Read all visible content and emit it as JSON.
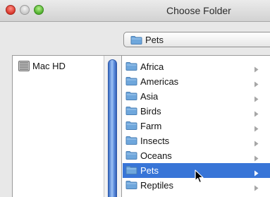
{
  "window": {
    "title": "Choose Folder"
  },
  "path_popup": {
    "selected": "Pets",
    "icon": "folder-icon"
  },
  "sidebar": {
    "items": [
      {
        "label": "Mac HD",
        "icon": "hard-drive-icon"
      }
    ]
  },
  "column": {
    "items": [
      {
        "label": "Africa",
        "selected": false
      },
      {
        "label": "Americas",
        "selected": false
      },
      {
        "label": "Asia",
        "selected": false
      },
      {
        "label": "Birds",
        "selected": false
      },
      {
        "label": "Farm",
        "selected": false
      },
      {
        "label": "Insects",
        "selected": false
      },
      {
        "label": "Oceans",
        "selected": false
      },
      {
        "label": "Pets",
        "selected": true
      },
      {
        "label": "Reptiles",
        "selected": false
      }
    ]
  },
  "colors": {
    "selection": "#3875d7",
    "scroll_thumb": "#5f8fde",
    "folder": "#6fa7dc"
  },
  "icons": {
    "disclosure": "chevron-right-icon",
    "pointer": "mouse-cursor-icon"
  }
}
